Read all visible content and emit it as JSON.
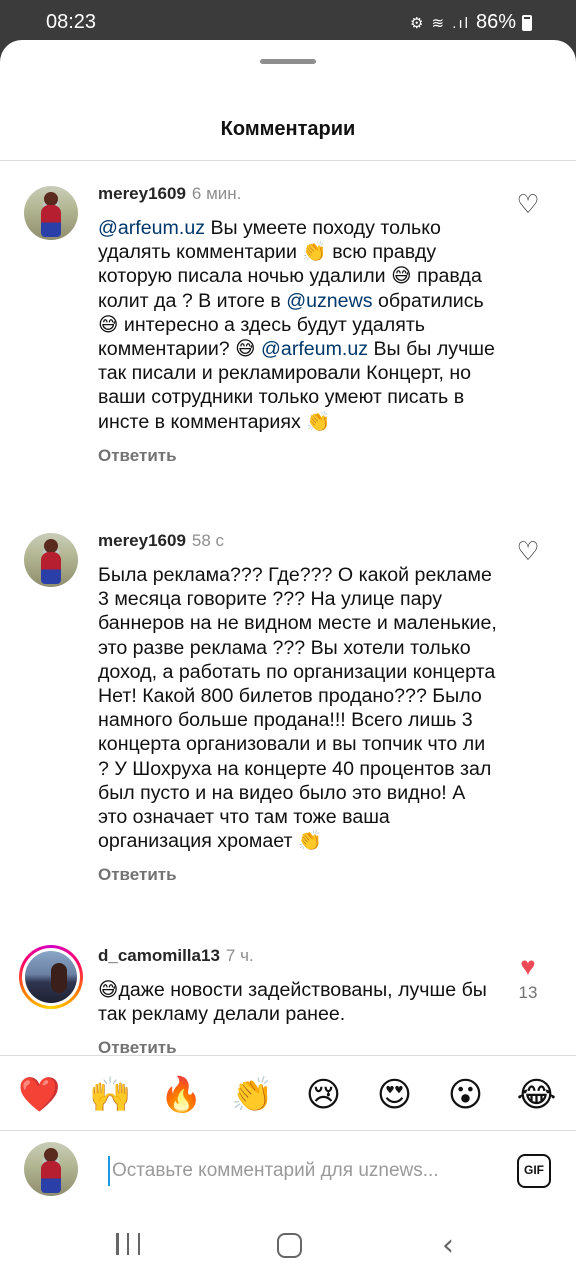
{
  "status_bar": {
    "time": "08:23",
    "battery": "86%",
    "icons": "⚙ ≋ .ıl"
  },
  "sheet": {
    "title": "Комментарии"
  },
  "comments": [
    {
      "user": "merey1609",
      "time": "6 мин.",
      "mention1": "@arfeum.uz",
      "part1": " Вы умеете походу только удалять комментарии ",
      "emoji1": "👏",
      "part2": " всю правду которую писала ночью удалили ",
      "emoji2": "😅",
      "part3": " правда колит да ? В итоге в ",
      "mention2": "@uznews",
      "part4": " обратились ",
      "emoji3": "😅",
      "part5": " интересно а здесь будут удалять комментарии? ",
      "emoji4": "😅",
      "mention3": "@arfeum.uz",
      "part6": " Вы бы лучше так писали и рекламировали Концерт, но ваши сотрудники только умеют писать в инсте в комментариях ",
      "emoji5": "👏",
      "reply": "Ответить",
      "heart": "♡"
    },
    {
      "user": "merey1609",
      "time": "58 с",
      "text": "Была реклама??? Где??? О какой рекламе 3 месяца говорите ??? На улице пару баннеров на не видном месте и маленькие, это разве реклама ??? Вы хотели только доход, а работать по организации концерта Нет! Какой 800 билетов продано??? Было намного больше продана!!!  Всего лишь 3 концерта организовали и вы топчик что ли ? У Шохруха на концерте 40 процентов зал был пусто и на видео было это видно! А это означает что там тоже ваша организация хромает ",
      "emoji": "👏",
      "reply": "Ответить",
      "heart": "♡"
    },
    {
      "user": "d_camomilla13",
      "time": "7 ч.",
      "emoji": "😅",
      "text": "даже новости задействованы,  лучше бы так рекламу делали ранее.",
      "reply": "Ответить",
      "heart": "♥",
      "likes": "13"
    }
  ],
  "quick_emojis": [
    "❤️",
    "🙌",
    "🔥",
    "👏",
    "😢",
    "😍",
    "😮",
    "😂"
  ],
  "composer": {
    "placeholder": "Оставьте комментарий для uznews...",
    "gif_label": "GIF"
  },
  "colors": {
    "mention": "#00376b",
    "like_red": "#ed4956",
    "muted": "#8e8e8e"
  },
  "nav_icons": [
    "recents-icon",
    "home-icon",
    "back-icon"
  ]
}
